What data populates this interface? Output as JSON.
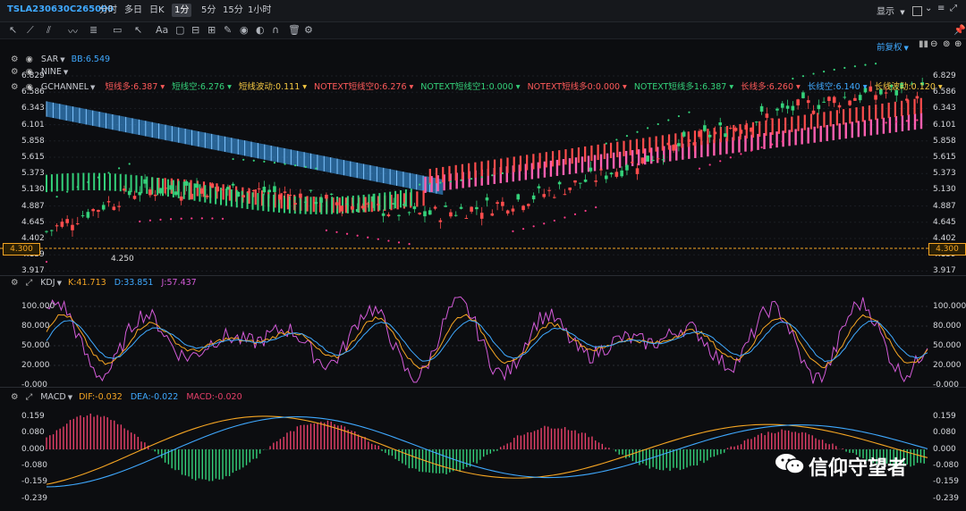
{
  "header": {
    "symbol": "TSLA230630C265000",
    "timeframes": [
      "分时",
      "多日",
      "日K",
      "1分",
      "5分",
      "15分",
      "1小时"
    ],
    "active_timeframe": "1分",
    "display_label": "显示",
    "display_caret": "▼"
  },
  "subbar": {
    "adjust_label": "前复权",
    "adjust_caret": "▼"
  },
  "main_panel": {
    "ind1_name": "SAR",
    "ind1_caret": "▼",
    "ind1_value": "BB:6.549",
    "ind2_name": "NINE",
    "ind2_caret": "▼",
    "ind3_name": "GCHANNEL",
    "ind3_caret": "▼",
    "gchannel_items": [
      {
        "label": "短线多:6.387",
        "color": "#ff5a5a"
      },
      {
        "label": "短线空:6.276",
        "color": "#34d17a"
      },
      {
        "label": "短线波动:0.111",
        "color": "#f5c842"
      },
      {
        "label": "NOTEXT短线空0:6.276",
        "color": "#ff5a5a"
      },
      {
        "label": "NOTEXT短线空1:0.000",
        "color": "#34d17a"
      },
      {
        "label": "NOTEXT短线多0:0.000",
        "color": "#ff5a5a"
      },
      {
        "label": "NOTEXT短线多1:6.387",
        "color": "#34d17a"
      },
      {
        "label": "长线多:6.260",
        "color": "#ff5a5a"
      },
      {
        "label": "长线空:6.140",
        "color": "#3fa9ff"
      },
      {
        "label": "长线波动:0.120",
        "color": "#f5c842"
      }
    ],
    "y_labels": [
      "6.829",
      "6.586",
      "6.343",
      "6.101",
      "5.858",
      "5.615",
      "5.373",
      "5.130",
      "4.887",
      "4.645",
      "4.402",
      "4.159",
      "3.917"
    ],
    "current_price": "4.300",
    "low_label": "4.250"
  },
  "kdj_panel": {
    "name": "KDJ",
    "caret": "▼",
    "k": "K:41.713",
    "d": "D:33.851",
    "j": "J:57.437",
    "y_labels": [
      "100.000",
      "80.000",
      "50.000",
      "20.000",
      "-0.000"
    ],
    "colors": {
      "k": "#f6a623",
      "d": "#3fa9ff",
      "j": "#d35bd8"
    }
  },
  "macd_panel": {
    "name": "MACD",
    "caret": "▼",
    "dif": "DIF:-0.032",
    "dea": "DEA:-0.022",
    "macd": "MACD:-0.020",
    "y_labels": [
      "0.159",
      "0.080",
      "0.000",
      "-0.080",
      "-0.159",
      "-0.239"
    ],
    "colors": {
      "dif": "#f6a623",
      "dea": "#3fa9ff",
      "macd": "#e8406a"
    }
  },
  "watermark": {
    "text": "信仰守望者"
  }
}
